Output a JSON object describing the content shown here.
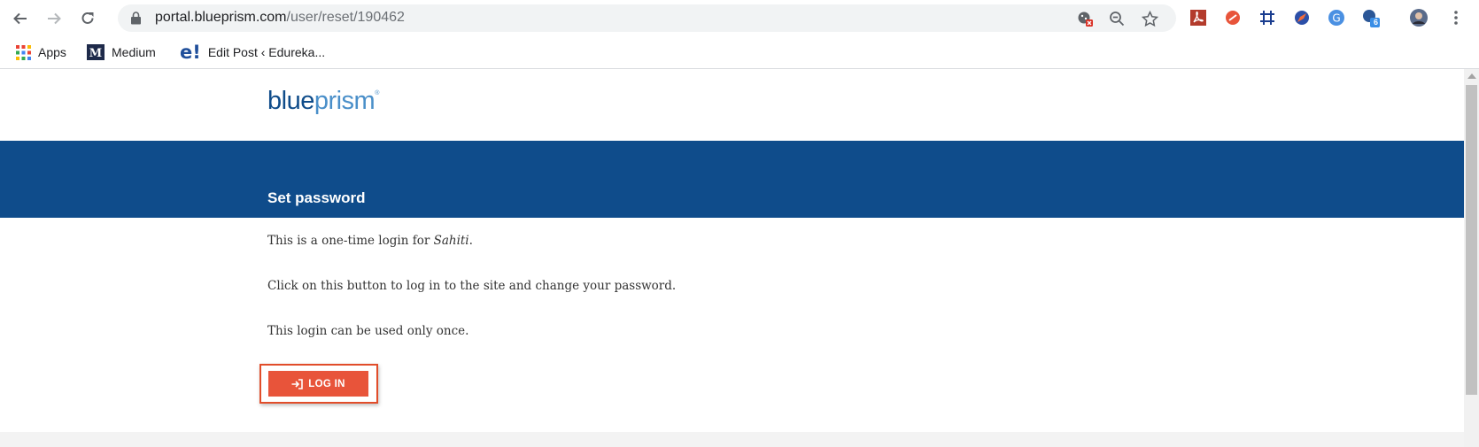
{
  "browser": {
    "url_host": "portal.blueprism.com",
    "url_path": "/user/reset/190462",
    "extension_badge": "6"
  },
  "bookmarks": [
    {
      "label": "Apps",
      "icon": "apps-grid-icon"
    },
    {
      "label": "Medium",
      "icon": "medium-icon"
    },
    {
      "label": "Edit Post ‹ Edureka...",
      "icon": "edureka-icon"
    }
  ],
  "site": {
    "logo_part1": "blue",
    "logo_part2": "prism",
    "banner_title": "Set password",
    "line1_prefix": "This is a one-time login for ",
    "line1_name": "Sahiti",
    "line1_suffix": ".",
    "line2": "Click on this button to log in to the site and change your password.",
    "line3": "This login can be used only once.",
    "login_label": "LOG IN"
  },
  "colors": {
    "banner": "#0f4c8b",
    "login_button": "#e8543a",
    "login_outline": "#e14d2a"
  }
}
